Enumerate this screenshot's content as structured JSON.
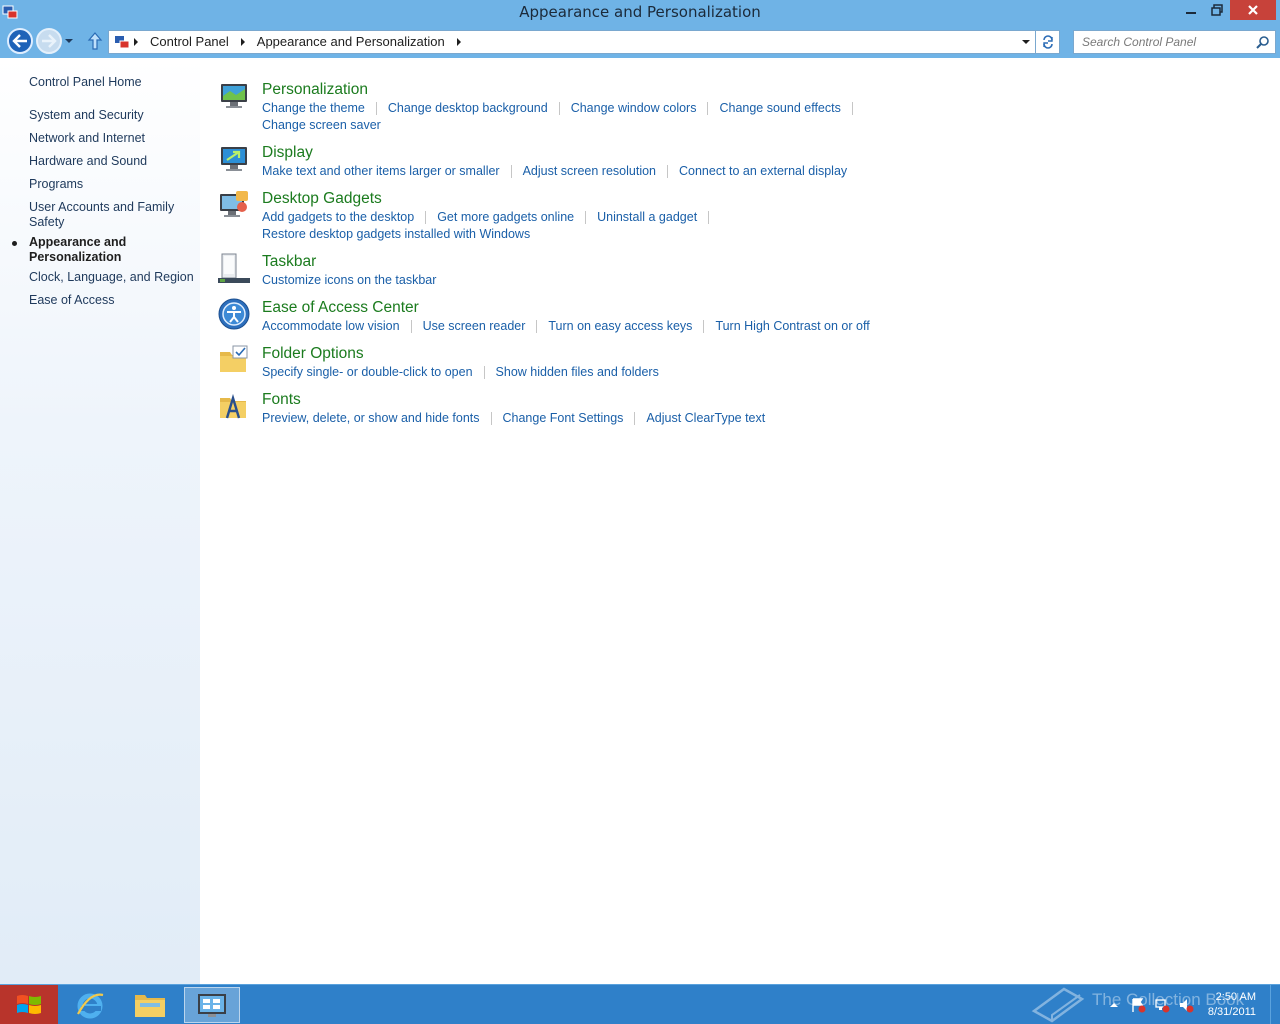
{
  "window": {
    "title": "Appearance and Personalization",
    "buttons": {
      "minimize": "minimize-icon",
      "maximize": "restore-icon",
      "close": "close-icon"
    }
  },
  "navbar": {
    "breadcrumb": [
      "Control Panel",
      "Appearance and Personalization"
    ],
    "search_placeholder": "Search Control Panel"
  },
  "sidebar": {
    "items": [
      {
        "label": "Control Panel Home",
        "current": false
      },
      {
        "label": "System and Security",
        "current": false
      },
      {
        "label": "Network and Internet",
        "current": false
      },
      {
        "label": "Hardware and Sound",
        "current": false
      },
      {
        "label": "Programs",
        "current": false
      },
      {
        "label": "User Accounts and Family Safety",
        "current": false
      },
      {
        "label": "Appearance and Personalization",
        "current": true
      },
      {
        "label": "Clock, Language, and Region",
        "current": false
      },
      {
        "label": "Ease of Access",
        "current": false
      }
    ]
  },
  "categories": [
    {
      "title": "Personalization",
      "icon": "personalization-icon",
      "lines": [
        [
          "Change the theme",
          "Change desktop background",
          "Change window colors",
          "Change sound effects"
        ],
        [
          "Change screen saver"
        ]
      ]
    },
    {
      "title": "Display",
      "icon": "display-icon",
      "lines": [
        [
          "Make text and other items larger or smaller",
          "Adjust screen resolution",
          "Connect to an external display"
        ]
      ]
    },
    {
      "title": "Desktop Gadgets",
      "icon": "desktop-gadgets-icon",
      "lines": [
        [
          "Add gadgets to the desktop",
          "Get more gadgets online",
          "Uninstall a gadget"
        ],
        [
          "Restore desktop gadgets installed with Windows"
        ]
      ]
    },
    {
      "title": "Taskbar",
      "icon": "taskbar-icon",
      "lines": [
        [
          "Customize icons on the taskbar"
        ]
      ]
    },
    {
      "title": "Ease of Access Center",
      "icon": "ease-of-access-icon",
      "lines": [
        [
          "Accommodate low vision",
          "Use screen reader",
          "Turn on easy access keys",
          "Turn High Contrast on or off"
        ]
      ]
    },
    {
      "title": "Folder Options",
      "icon": "folder-options-icon",
      "lines": [
        [
          "Specify single- or double-click to open",
          "Show hidden files and folders"
        ]
      ]
    },
    {
      "title": "Fonts",
      "icon": "fonts-icon",
      "lines": [
        [
          "Preview, delete, or show and hide fonts",
          "Change Font Settings",
          "Adjust ClearType text"
        ]
      ]
    }
  ],
  "taskbar": {
    "apps": [
      "internet-explorer-icon",
      "file-explorer-icon",
      "control-panel-icon"
    ],
    "clock": {
      "time": "2:50 AM",
      "date": "8/31/2011"
    },
    "watermark": "The Collection Book"
  }
}
